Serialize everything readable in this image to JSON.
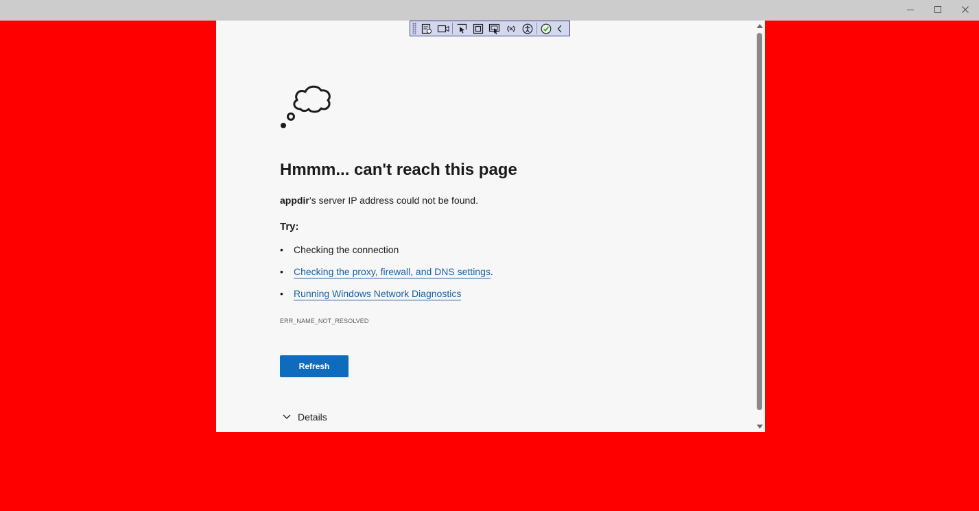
{
  "window": {
    "controls": {
      "minimize_icon": "minimize-icon",
      "maximize_icon": "maximize-icon",
      "close_icon": "close-icon"
    },
    "background_color": "#ff0000"
  },
  "dev_toolbar": {
    "icons": [
      "live-visual-tree-icon",
      "record-icon",
      "select-element-icon",
      "display-layout-adorners-icon",
      "track-focus-icon",
      "binding-failures-icon",
      "accessibility-icon",
      "checkmark-icon",
      "collapse-chevron-icon"
    ]
  },
  "error_page": {
    "title": "Hmmm... can't reach this page",
    "host": "appdir",
    "message_rest": "’s server IP address could not be found.",
    "try_label": "Try:",
    "suggestions": [
      {
        "text": "Checking the connection",
        "link": false
      },
      {
        "text": "Checking the proxy, firewall, and DNS settings",
        "link": true,
        "suffix": "."
      },
      {
        "text": "Running Windows Network Diagnostics",
        "link": true
      }
    ],
    "bullet": "•",
    "error_code": "ERR_NAME_NOT_RESOLVED",
    "refresh_label": "Refresh",
    "details_label": "Details",
    "accent_color": "#0f6cbd",
    "link_color": "#1a5fa8"
  }
}
